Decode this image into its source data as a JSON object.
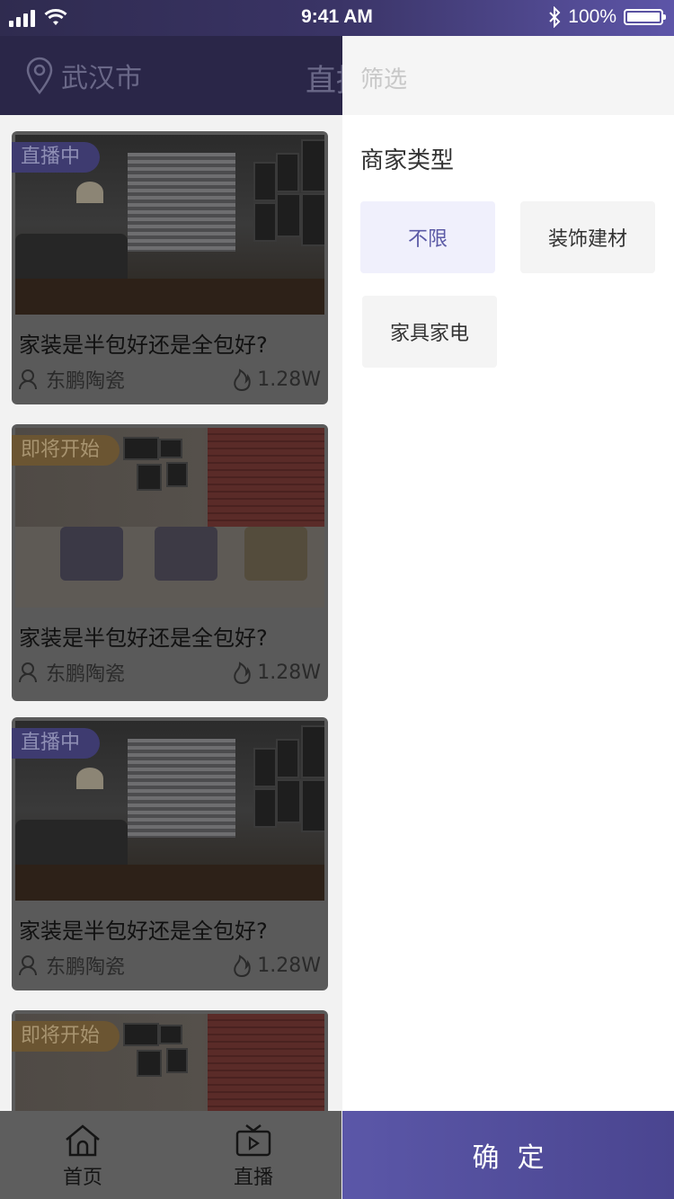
{
  "status_bar": {
    "time": "9:41 AM",
    "battery": "100%"
  },
  "header": {
    "location": "武汉市",
    "title_partial": "直播"
  },
  "cards": [
    {
      "tag": "直播中",
      "tag_type": "live",
      "title": "家装是半包好还是全包好?",
      "shop": "东鹏陶瓷",
      "heat": "1.28W"
    },
    {
      "tag": "即将开始",
      "tag_type": "soon",
      "title": "家装是半包好还是全包好?",
      "shop": "东鹏陶瓷",
      "heat": "1.28W"
    },
    {
      "tag": "直播中",
      "tag_type": "live",
      "title": "家装是半包好还是全包好?",
      "shop": "东鹏陶瓷",
      "heat": "1.28W"
    },
    {
      "tag": "即将开始",
      "tag_type": "soon",
      "title": "",
      "shop": "",
      "heat": ""
    }
  ],
  "tabbar": {
    "home": "首页",
    "live": "直播"
  },
  "drawer": {
    "header": "筛选",
    "section_title": "商家类型",
    "options": [
      {
        "label": "不限",
        "selected": true
      },
      {
        "label": "装饰建材",
        "selected": false
      },
      {
        "label": "家具家电",
        "selected": false
      }
    ],
    "confirm": "确定"
  },
  "colors": {
    "accent": "#5b57a8",
    "selected_bg": "#f0f0fc",
    "header_bg": "#2a2648"
  }
}
